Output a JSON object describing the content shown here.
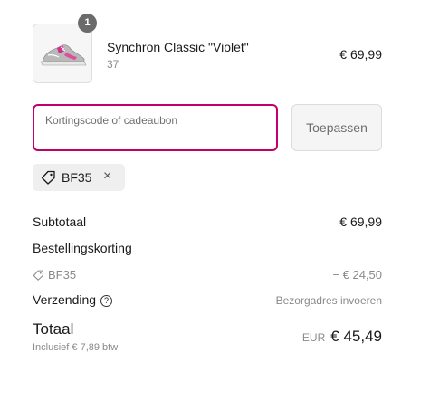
{
  "product": {
    "name": "Synchron Classic \"Violet\"",
    "variant": "37",
    "price": "€ 69,99",
    "quantity": "1",
    "image_icon": "sneaker-image"
  },
  "discount": {
    "placeholder": "Kortingscode of cadeaubon",
    "value": "",
    "apply_label": "Toepassen",
    "applied_code": "BF35",
    "remove_symbol": "×"
  },
  "summary": {
    "subtotal_label": "Subtotaal",
    "subtotal_value": "€ 69,99",
    "order_discount_label": "Bestellingskorting",
    "discount_code": "BF35",
    "discount_value": "− € 24,50",
    "shipping_label": "Verzending",
    "shipping_value": "Bezorgadres invoeren",
    "help_symbol": "?",
    "total_label": "Totaal",
    "tax_note": "Inclusief € 7,89 btw",
    "total_currency": "EUR",
    "total_value": "€ 45,49"
  },
  "colors": {
    "accent": "#c2006b",
    "badge": "#6b6b6b",
    "muted_text": "#8a8a8a"
  }
}
